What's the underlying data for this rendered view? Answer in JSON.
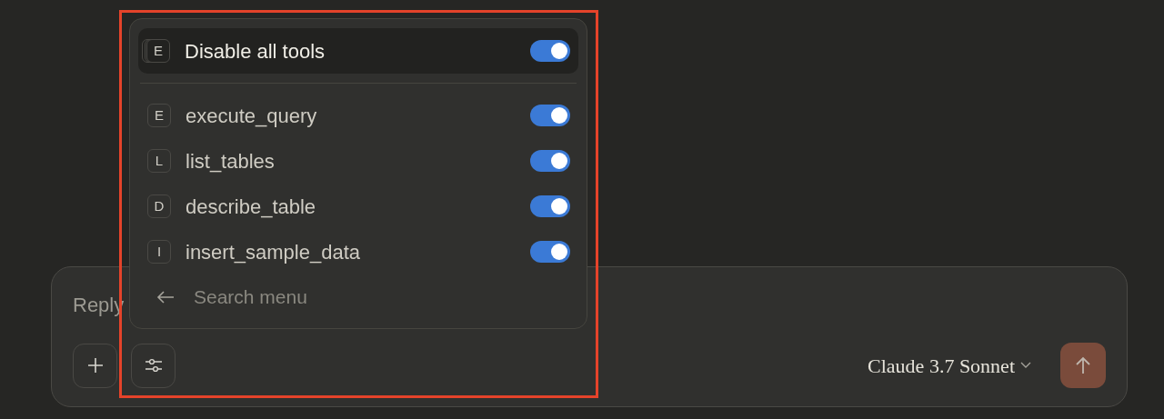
{
  "menu": {
    "header": {
      "badge": "E",
      "label": "Disable all tools",
      "on": true
    },
    "tools": [
      {
        "badge": "E",
        "label": "execute_query",
        "on": true
      },
      {
        "badge": "L",
        "label": "list_tables",
        "on": true
      },
      {
        "badge": "D",
        "label": "describe_table",
        "on": true
      },
      {
        "badge": "I",
        "label": "insert_sample_data",
        "on": true
      }
    ],
    "search": {
      "placeholder": "Search menu"
    }
  },
  "composer": {
    "placeholder": "Reply",
    "model": "Claude 3.7 Sonnet"
  }
}
